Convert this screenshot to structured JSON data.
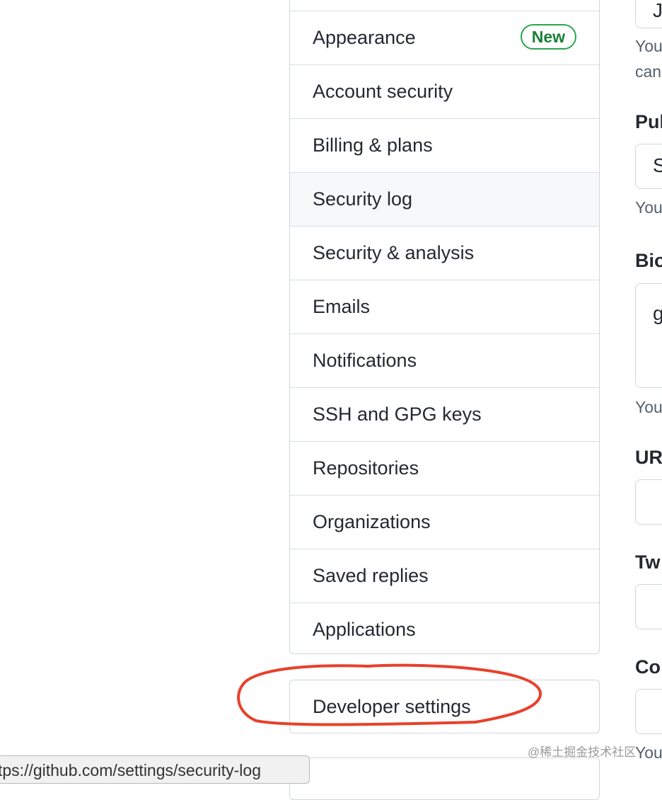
{
  "settings_nav": {
    "items": [
      {
        "label": "Appearance",
        "badge": "New",
        "active": false
      },
      {
        "label": "Account security",
        "active": false
      },
      {
        "label": "Billing & plans",
        "active": false
      },
      {
        "label": "Security log",
        "active": true
      },
      {
        "label": "Security & analysis",
        "active": false
      },
      {
        "label": "Emails",
        "active": false
      },
      {
        "label": "Notifications",
        "active": false
      },
      {
        "label": "SSH and GPG keys",
        "active": false
      },
      {
        "label": "Repositories",
        "active": false
      },
      {
        "label": "Organizations",
        "active": false
      },
      {
        "label": "Saved replies",
        "active": false
      },
      {
        "label": "Applications",
        "active": false
      }
    ],
    "developer_settings": "Developer settings"
  },
  "profile_form": {
    "name_value_partial": "Ja",
    "name_note_line1": "You",
    "name_note_line2": "can",
    "public_email_label": "Pul",
    "public_email_value": "S",
    "public_email_note": "You",
    "bio_label": "Bio",
    "bio_value": "g",
    "bio_note": "You",
    "url_label": "UR",
    "twitter_label": "Tw",
    "company_label": "Co",
    "company_note": "You"
  },
  "status_bar": {
    "url": "tps://github.com/settings/security-log"
  },
  "watermark": "@稀土掘金技术社区",
  "colors": {
    "badge_green": "#2da44e",
    "annotation_red": "#e8402a",
    "active_bg": "#f6f8fa"
  }
}
